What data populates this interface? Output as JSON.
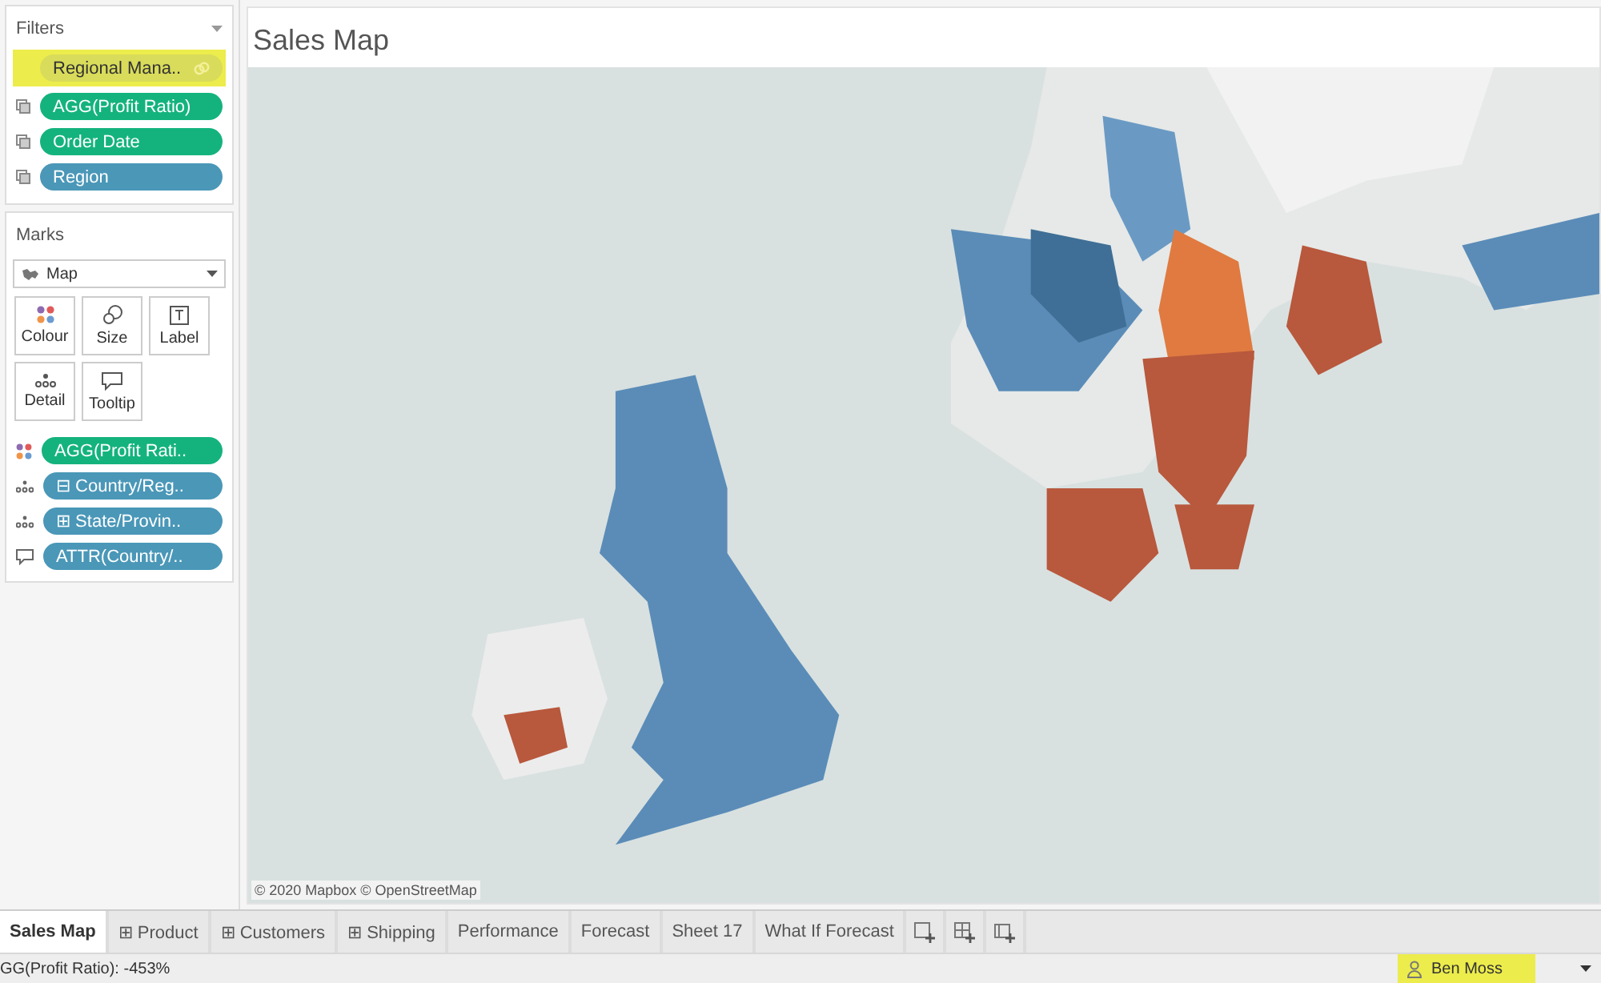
{
  "filters": {
    "title": "Filters",
    "pills": [
      {
        "label": "Regional Mana..",
        "color": "#d9dc5a",
        "highlighted": true,
        "linked": true
      },
      {
        "label": "AGG(Profit Ratio)",
        "color": "#14b37d",
        "highlighted": false,
        "linked": false
      },
      {
        "label": "Order Date",
        "color": "#14b37d",
        "highlighted": false,
        "linked": false
      },
      {
        "label": "Region",
        "color": "#4a97b8",
        "highlighted": false,
        "linked": false
      }
    ]
  },
  "marks": {
    "title": "Marks",
    "mark_type": "Map",
    "cards": [
      {
        "kind": "colour",
        "label": "Colour"
      },
      {
        "kind": "size",
        "label": "Size"
      },
      {
        "kind": "label",
        "label": "Label"
      },
      {
        "kind": "detail",
        "label": "Detail"
      },
      {
        "kind": "tooltip",
        "label": "Tooltip"
      }
    ],
    "pills": [
      {
        "kind": "colour",
        "label": "AGG(Profit Rati..",
        "color": "#14b37d"
      },
      {
        "kind": "detail",
        "label": "⊟ Country/Reg..",
        "color": "#4a97b8"
      },
      {
        "kind": "detail",
        "label": "⊞ State/Provin..",
        "color": "#4a97b8"
      },
      {
        "kind": "tooltip",
        "label": "ATTR(Country/..",
        "color": "#4a97b8"
      }
    ]
  },
  "view": {
    "title": "Sales Map",
    "attribution": "© 2020 Mapbox © OpenStreetMap"
  },
  "tabs": [
    {
      "label": "Sales Map",
      "selected": true
    },
    {
      "label": "⊞ Product",
      "selected": false
    },
    {
      "label": "⊞ Customers",
      "selected": false
    },
    {
      "label": "⊞ Shipping",
      "selected": false
    },
    {
      "label": "Performance",
      "selected": false
    },
    {
      "label": "Forecast",
      "selected": false
    },
    {
      "label": "Sheet 17",
      "selected": false
    },
    {
      "label": "What If Forecast",
      "selected": false
    }
  ],
  "status_bar": {
    "text": "GG(Profit Ratio): -453%",
    "user": "Ben Moss",
    "user_highlighted": true
  }
}
